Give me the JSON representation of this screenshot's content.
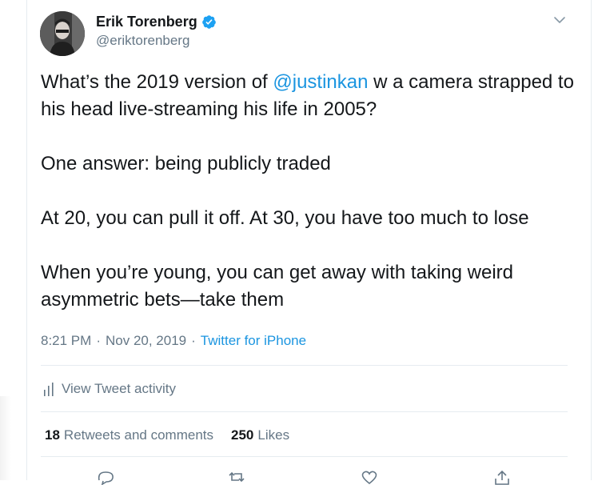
{
  "author": {
    "name": "Erik Torenberg",
    "handle": "@eriktorenberg"
  },
  "tweet": {
    "paragraphs": [
      {
        "before": "What’s the 2019 version of ",
        "mention": "@justinkan",
        "after": " w a camera strapped to his head live-streaming his life in 2005?"
      },
      {
        "text": "One answer: being publicly traded"
      },
      {
        "text": "At 20, you can pull it off. At 30, you have too much to lose"
      },
      {
        "text": "When you’re young, you can get away with taking weird asymmetric bets—take them"
      }
    ]
  },
  "meta": {
    "time": "8:21 PM",
    "sep1": "·",
    "date": "Nov 20, 2019",
    "sep2": "·",
    "source": "Twitter for iPhone"
  },
  "activity_label": "View Tweet activity",
  "stats": {
    "retweets_count": "18",
    "retweets_label": "Retweets and comments",
    "likes_count": "250",
    "likes_label": "Likes"
  },
  "colors": {
    "link": "#1b95e0",
    "secondary_text": "#657786",
    "primary_text": "#14171a",
    "divider": "#e6ecf0"
  },
  "icons": {
    "verified": "verified-badge-icon",
    "caret": "chevron-down-icon",
    "activity": "bar-chart-icon",
    "reply": "reply-icon",
    "retweet": "retweet-icon",
    "like": "heart-icon",
    "share": "share-icon"
  }
}
